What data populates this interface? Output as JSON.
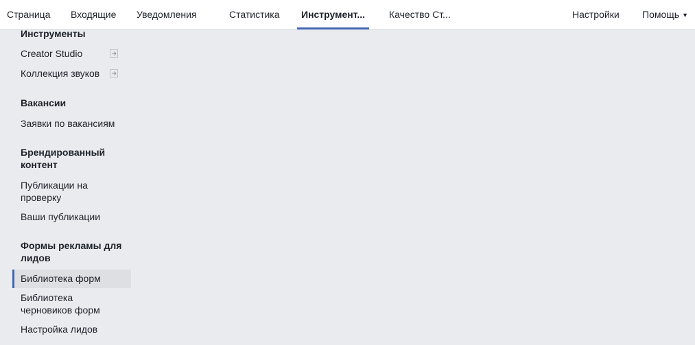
{
  "topnav": {
    "tabs": [
      {
        "label": "Страница"
      },
      {
        "label": "Входящие"
      },
      {
        "label": "Уведомления"
      },
      {
        "label": "Статистика"
      },
      {
        "label": "Инструмент..."
      },
      {
        "label": "Качество Ст..."
      }
    ],
    "active_tab": "Инструмент...",
    "settings_label": "Настройки",
    "help_label": "Помощь",
    "accent_color": "#4267b2"
  },
  "sidebar": {
    "sections": [
      {
        "title": "Инструменты",
        "items": [
          {
            "label": "Creator Studio",
            "icon": "external-link-icon"
          },
          {
            "label": "Коллекция звуков",
            "icon": "external-link-icon"
          }
        ]
      },
      {
        "title": "Вакансии",
        "items": [
          {
            "label": "Заявки по вакансиям"
          }
        ]
      },
      {
        "title": "Брендированный контент",
        "items": [
          {
            "label": "Публикации на проверку"
          },
          {
            "label": "Ваши публикации"
          }
        ]
      },
      {
        "title": "Формы рекламы для лидов",
        "items": [
          {
            "label": "Библиотека форм",
            "selected": true
          },
          {
            "label": "Библиотека черновиков форм"
          },
          {
            "label": "Настройка лидов"
          }
        ]
      }
    ]
  }
}
